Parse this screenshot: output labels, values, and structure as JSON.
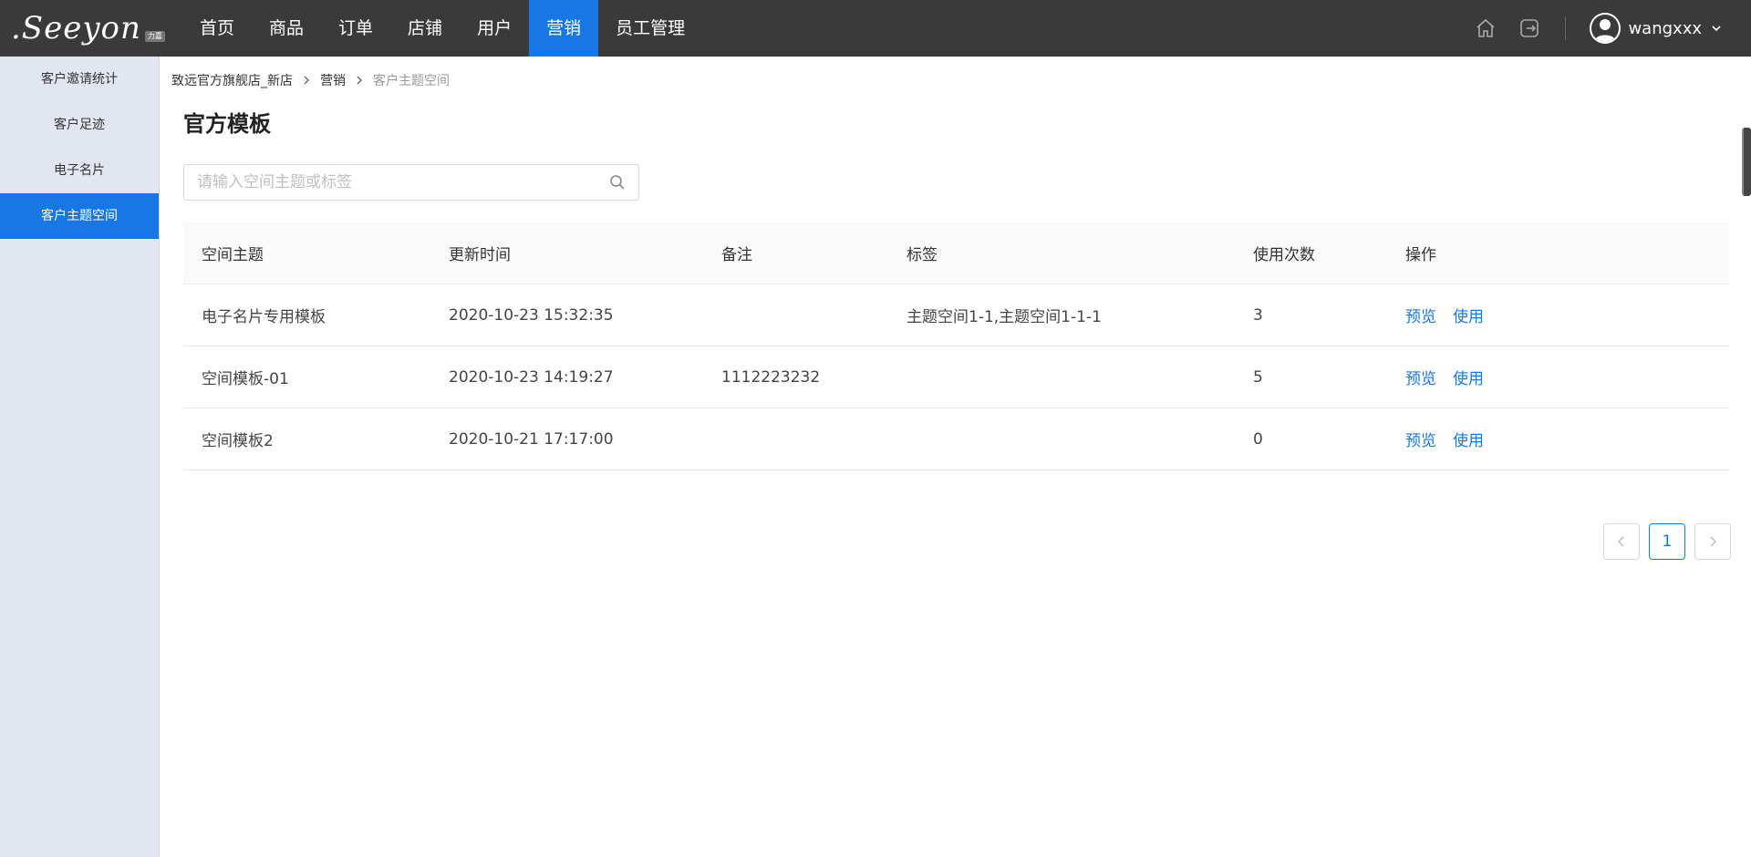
{
  "brand": {
    "name": ".Seeyon",
    "badge": "力嘉"
  },
  "nav": {
    "items": [
      {
        "label": "首页"
      },
      {
        "label": "商品"
      },
      {
        "label": "订单"
      },
      {
        "label": "店铺"
      },
      {
        "label": "用户"
      },
      {
        "label": "营销",
        "active": true
      },
      {
        "label": "员工管理"
      }
    ]
  },
  "user": {
    "name": "wangxxx"
  },
  "sidebar": {
    "items": [
      {
        "label": "客户邀请统计"
      },
      {
        "label": "客户足迹"
      },
      {
        "label": "电子名片"
      },
      {
        "label": "客户主题空间",
        "active": true
      }
    ]
  },
  "breadcrumb": {
    "store": "致远官方旗舰店_新店",
    "section": "营销",
    "current": "客户主题空间"
  },
  "page": {
    "title": "官方模板"
  },
  "search": {
    "placeholder": "请输入空间主题或标签",
    "value": ""
  },
  "table": {
    "headers": [
      "空间主题",
      "更新时间",
      "备注",
      "标签",
      "使用次数",
      "操作"
    ],
    "rows": [
      {
        "theme": "电子名片专用模板",
        "updated": "2020-10-23 15:32:35",
        "note": "",
        "tags": "主题空间1-1,主题空间1-1-1",
        "count": "3"
      },
      {
        "theme": "空间模板-01",
        "updated": "2020-10-23 14:19:27",
        "note": "1112223232",
        "tags": "",
        "count": "5"
      },
      {
        "theme": "空间模板2",
        "updated": "2020-10-21 17:17:00",
        "note": "",
        "tags": "",
        "count": "0"
      }
    ],
    "actions": {
      "preview": "预览",
      "use": "使用"
    }
  },
  "pagination": {
    "current": "1"
  },
  "colors": {
    "accent": "#1677e5",
    "topbar": "#3a3a3a",
    "sidebar": "#e1e6f0"
  }
}
